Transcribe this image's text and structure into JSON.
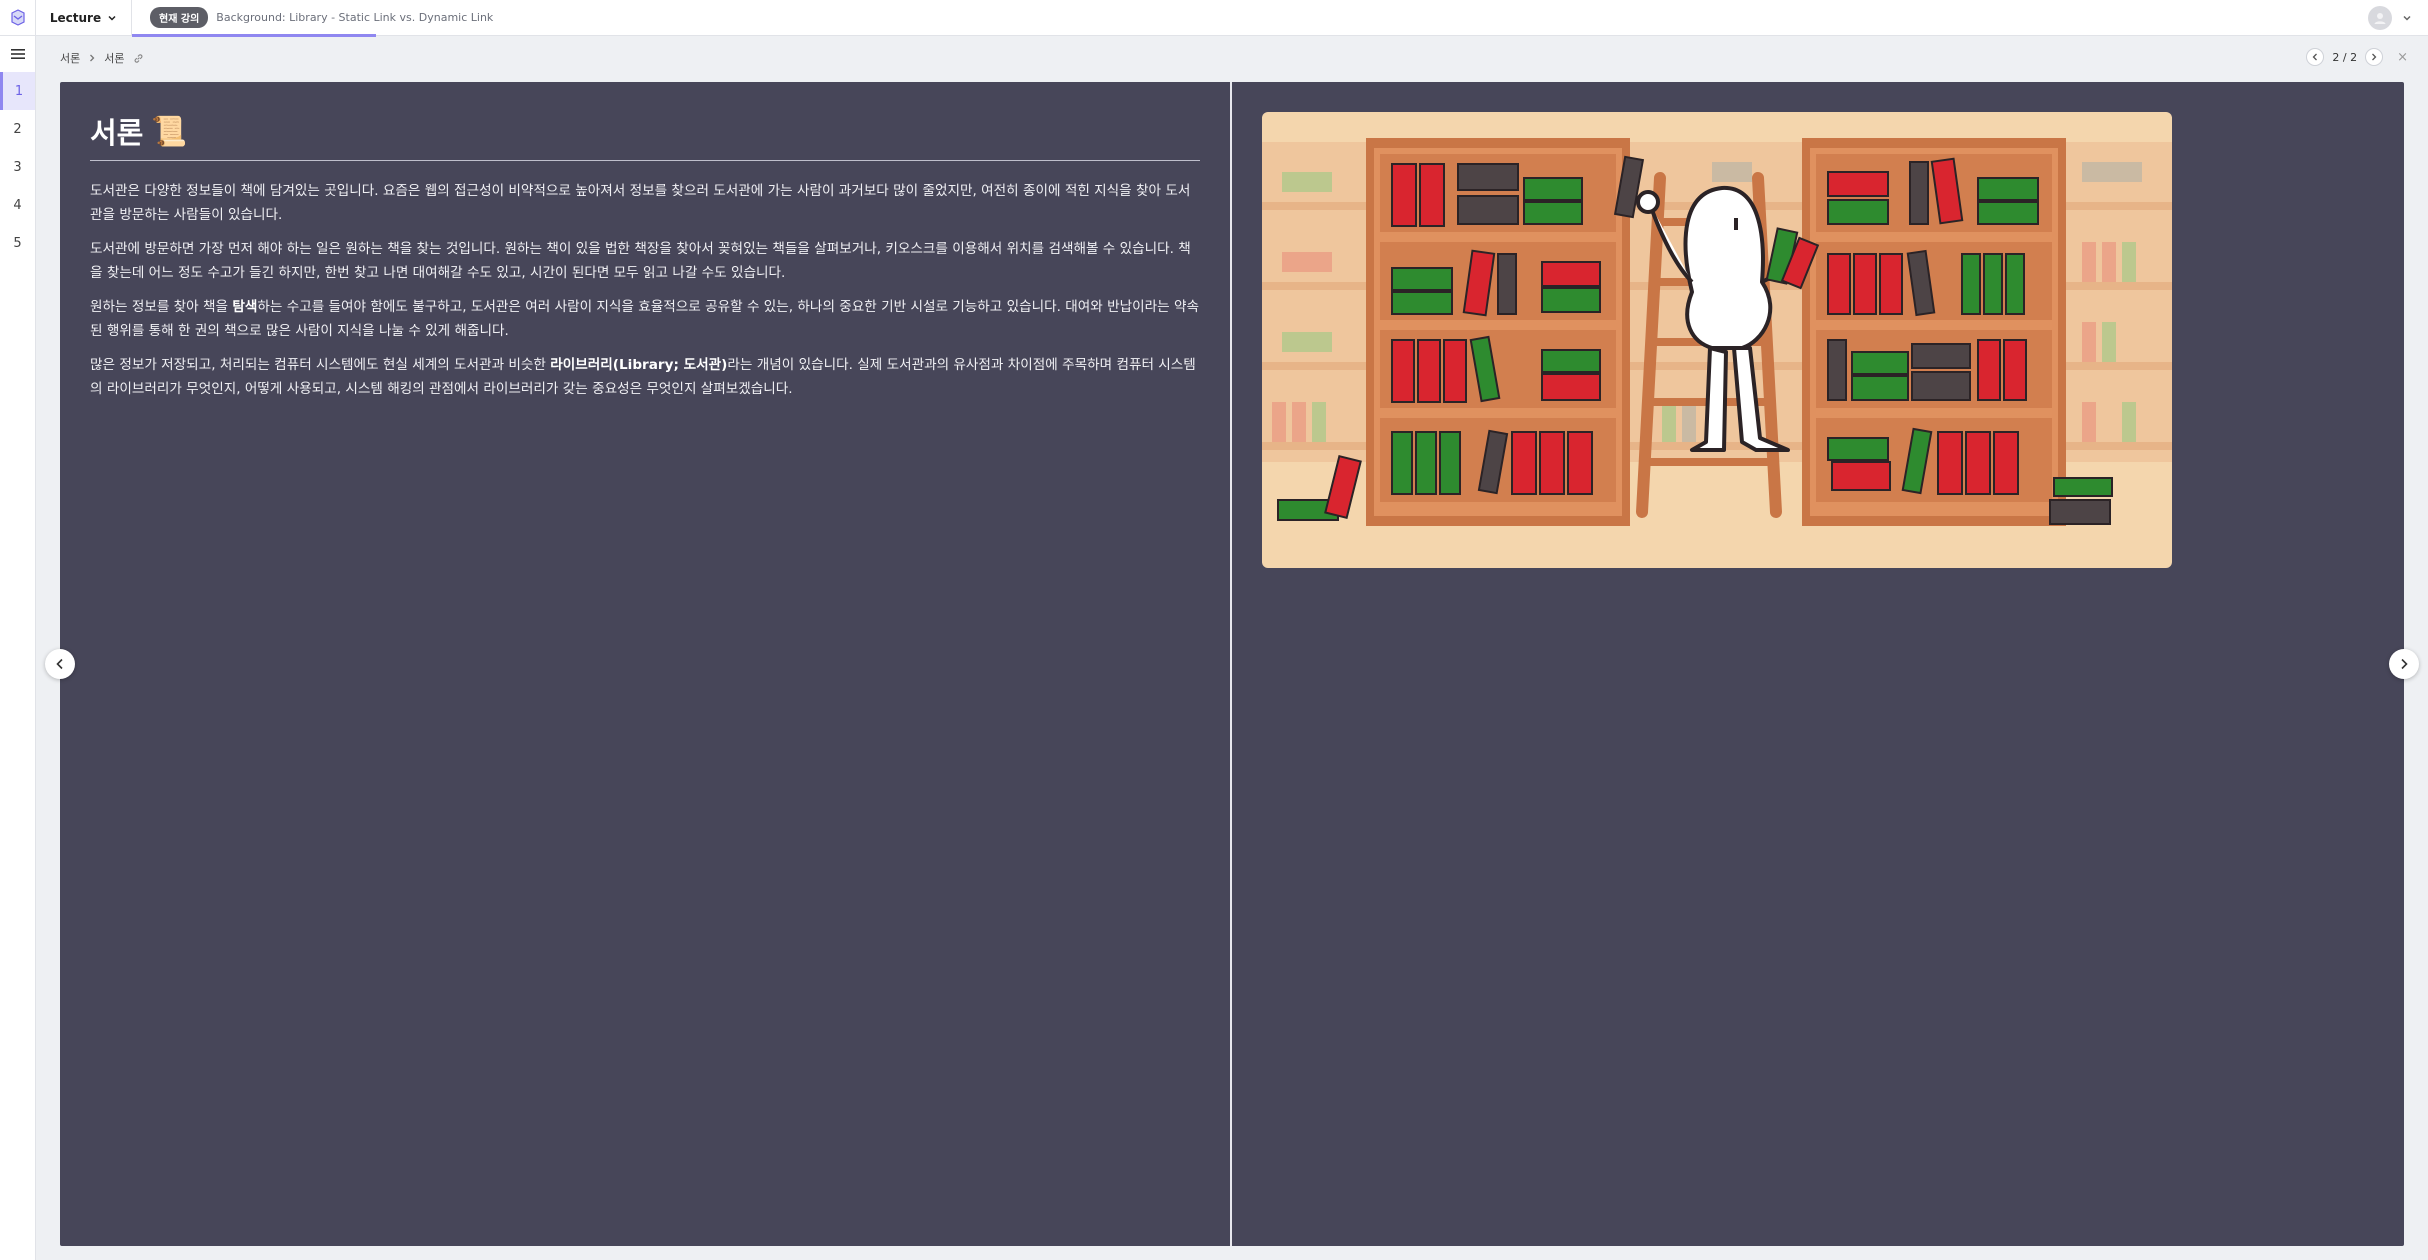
{
  "header": {
    "lecture_label": "Lecture",
    "badge": "현재 강의",
    "tab_title": "Background: Library - Static Link vs. Dynamic Link"
  },
  "sidebar": {
    "items": [
      {
        "label": "1",
        "active": true
      },
      {
        "label": "2"
      },
      {
        "label": "3"
      },
      {
        "label": "4"
      },
      {
        "label": "5"
      }
    ]
  },
  "breadcrumb": {
    "first": "서론",
    "second": "서론"
  },
  "pager": {
    "text": "2 / 2"
  },
  "slide": {
    "title": "서론",
    "title_emoji": "📜",
    "p1": "도서관은 다양한 정보들이 책에 담겨있는 곳입니다. 요즘은 웹의 접근성이 비약적으로 높아져서 정보를 찾으러 도서관에 가는 사람이 과거보다 많이 줄었지만, 여전히 종이에 적힌 지식을 찾아 도서관을 방문하는 사람들이 있습니다.",
    "p2": "도서관에 방문하면 가장 먼저 해야 하는 일은 원하는 책을 찾는 것입니다. 원하는 책이 있을 법한 책장을 찾아서 꽂혀있는 책들을 살펴보거나, 키오스크를 이용해서 위치를 검색해볼 수 있습니다. 책을 찾는데 어느 정도 수고가 들긴 하지만, 한번 찾고 나면 대여해갈 수도 있고, 시간이 된다면 모두 읽고 나갈 수도 있습니다.",
    "p3_before": "원하는 정보를 찾아 책을 ",
    "p3_bold": "탐색",
    "p3_after": "하는 수고를 들여야 함에도 불구하고, 도서관은 여러 사람이 지식을 효율적으로 공유할 수 있는, 하나의 중요한 기반 시설로 기능하고 있습니다. 대여와 반납이라는 약속된 행위를 통해 한 권의 책으로 많은 사람이 지식을 나눌 수 있게 해줍니다.",
    "p4_before": "많은 정보가 저장되고, 처리되는 컴퓨터 시스템에도 현실 세계의 도서관과 비슷한 ",
    "p4_bold": "라이브러리(Library; 도서관)",
    "p4_after": "라는 개념이 있습니다. 실제 도서관과의 유사점과 차이점에 주목하며 컴퓨터 시스템의 라이브러리가 무엇인지, 어떻게 사용되고, 시스템 해킹의 관점에서 라이브러리가 갖는 중요성은 무엇인지 살펴보겠습니다."
  },
  "colors": {
    "slide_bg": "#474659",
    "accent": "#8f87f0",
    "shelf": "#d9895a",
    "shelf_dark": "#c06f43",
    "book_red": "#d9252f",
    "book_green": "#2e8b2f",
    "book_gray": "#4d4446"
  }
}
